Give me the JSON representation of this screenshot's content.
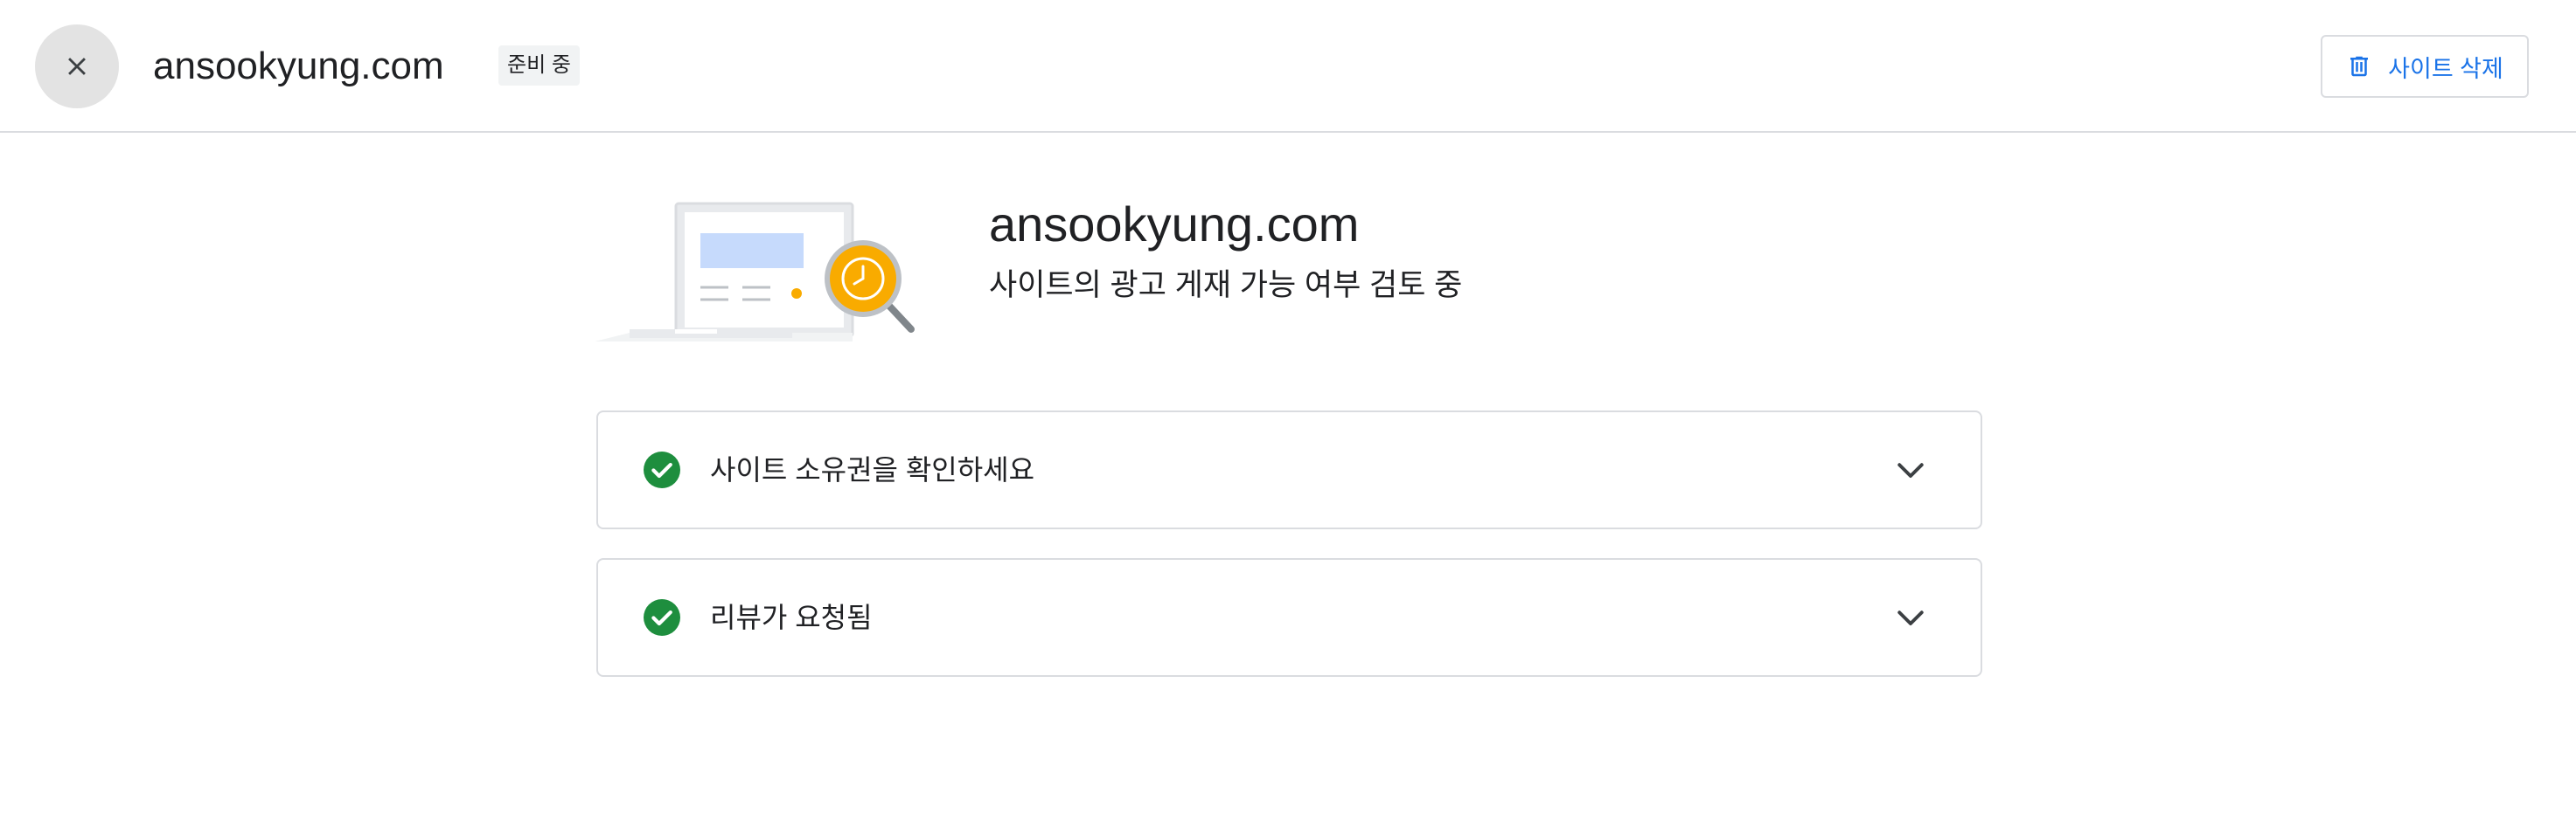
{
  "header": {
    "site_name": "ansookyung.com",
    "status_chip": "준비 중",
    "delete_button_label": "사이트 삭제",
    "close_icon": "close-icon",
    "delete_icon": "trash-icon"
  },
  "hero": {
    "title": "ansookyung.com",
    "subtitle": "사이트의 광고 게재 가능 여부 검토 중",
    "illustration": "site-review-magnifier-clock"
  },
  "steps": [
    {
      "label": "사이트 소유권을 확인하세요",
      "status": "complete",
      "icon": "check-circle-icon",
      "expand_icon": "chevron-down-icon"
    },
    {
      "label": "리뷰가 요청됨",
      "status": "complete",
      "icon": "check-circle-icon",
      "expand_icon": "chevron-down-icon"
    }
  ],
  "colors": {
    "accent_blue": "#1a73e8",
    "success_green": "#1e8e3e",
    "warning_yellow": "#f9ab00",
    "divider": "#dadce0"
  }
}
